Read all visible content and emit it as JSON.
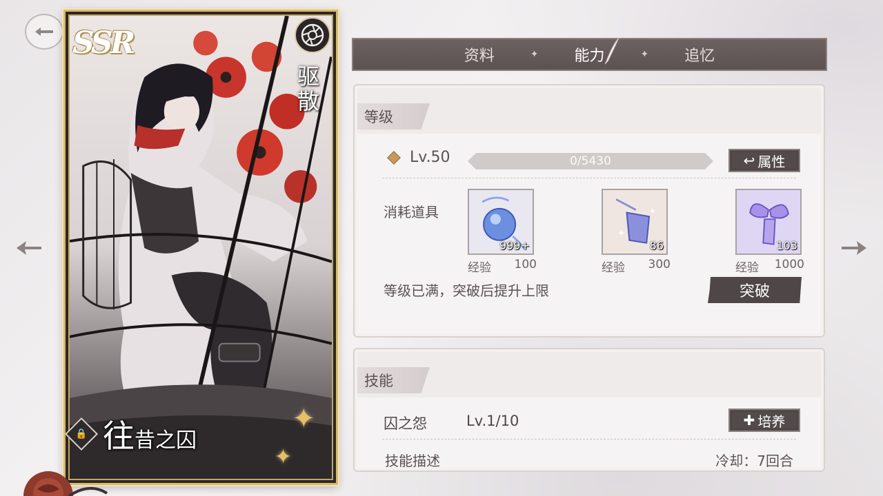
{
  "card": {
    "rarity": "SSR",
    "type_chars": [
      "驱",
      "散"
    ],
    "name_first": "往",
    "name_rest": "昔之囚"
  },
  "tabs": [
    "资料",
    "能力",
    "追忆"
  ],
  "active_tab": "能力",
  "level_section": {
    "header": "等级",
    "level": "Lv.50",
    "exp_text": "0/5430",
    "exp_progress": 0,
    "attr_button": "属性",
    "items_label": "消耗道具",
    "items": [
      {
        "count": "999+",
        "exp_label": "经验",
        "exp_value": "100",
        "color": "#5f7fd8"
      },
      {
        "count": "86",
        "exp_label": "经验",
        "exp_value": "300",
        "color": "#7c86d6"
      },
      {
        "count": "103",
        "exp_label": "经验",
        "exp_value": "1000",
        "color": "#9a82e0"
      }
    ],
    "max_text": "等级已满，突破后提升上限",
    "break_button": "突破"
  },
  "skill_section": {
    "header": "技能",
    "name": "囚之怨",
    "level": "Lv.1/10",
    "train_button": "培养",
    "desc_label": "技能描述",
    "cooldown": "冷却：7回合"
  },
  "colors": {
    "tab_bar": "#5c5252",
    "button_dark": "#524a4b",
    "card_gold": "#d9b96a",
    "accent_diamond": "#c79a5a"
  }
}
